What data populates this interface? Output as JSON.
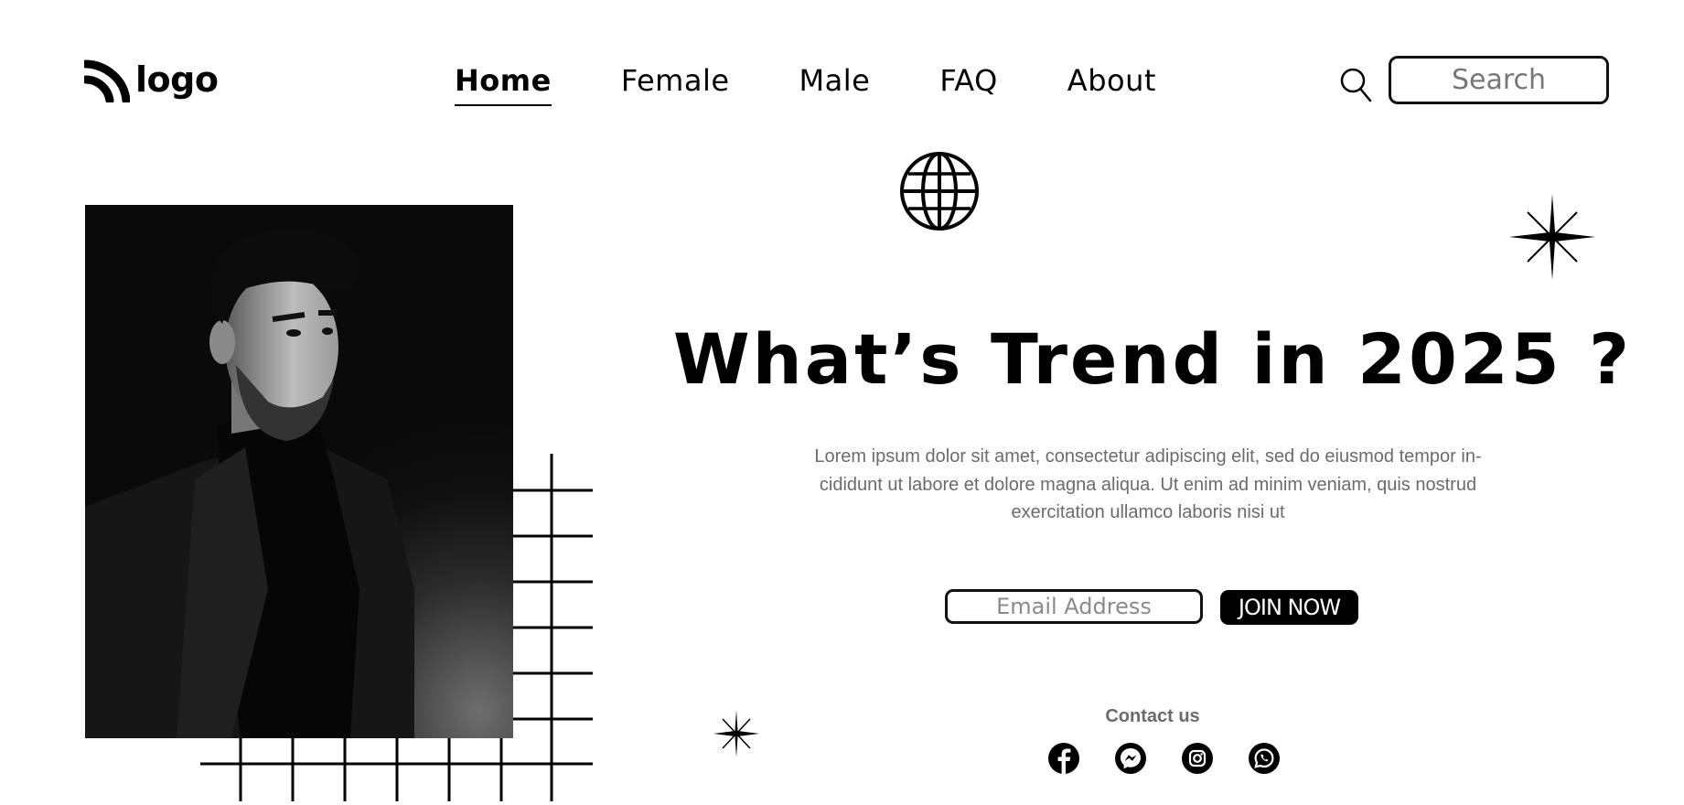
{
  "header": {
    "logo_text": "logo",
    "nav": [
      {
        "label": "Home",
        "active": true
      },
      {
        "label": "Female",
        "active": false
      },
      {
        "label": "Male",
        "active": false
      },
      {
        "label": "FAQ",
        "active": false
      },
      {
        "label": "About",
        "active": false
      }
    ],
    "search_placeholder": "Search"
  },
  "hero": {
    "headline": "What’s Trend in 2025 ?",
    "body_lines": [
      "Lorem ipsum dolor sit amet, consectetur adipiscing elit, sed do eiusmod tempor in-",
      "cididunt ut labore et dolore magna aliqua. Ut enim ad minim veniam, quis nostrud",
      "exercitation ullamco laboris nisi ut"
    ],
    "email_placeholder": "Email Address",
    "join_label": "JOIN NOW"
  },
  "contact": {
    "title": "Contact us",
    "icons": [
      "facebook-icon",
      "messenger-icon",
      "instagram-icon",
      "whatsapp-icon"
    ]
  },
  "colors": {
    "text": "#000000",
    "muted": "#6b6b6b",
    "background": "#ffffff",
    "button_bg": "#000000",
    "button_text": "#ffffff"
  }
}
